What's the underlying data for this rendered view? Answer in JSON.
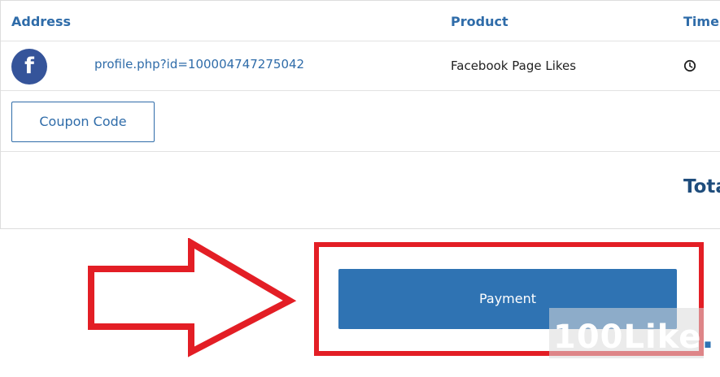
{
  "table": {
    "headers": {
      "address": "Address",
      "product": "Product",
      "time": "Time"
    },
    "row": {
      "platform_icon": "facebook-icon",
      "address": "profile.php?id=100004747275042",
      "product": "Facebook Page Likes",
      "time_icon": "clock-icon"
    }
  },
  "coupon": {
    "label": "Coupon Code"
  },
  "total": {
    "label": "Tota"
  },
  "payment": {
    "label": "Payment"
  },
  "annotation": {
    "arrow_icon": "right-arrow-icon",
    "color": "#e31e25"
  },
  "watermark": {
    "text": "100Like",
    "dot": "."
  },
  "colors": {
    "accent": "#2f6ca9",
    "payment_button": "#2f73b3",
    "facebook": "#35549a",
    "total": "#1f4d7c",
    "annotation_red": "#e31e25"
  }
}
